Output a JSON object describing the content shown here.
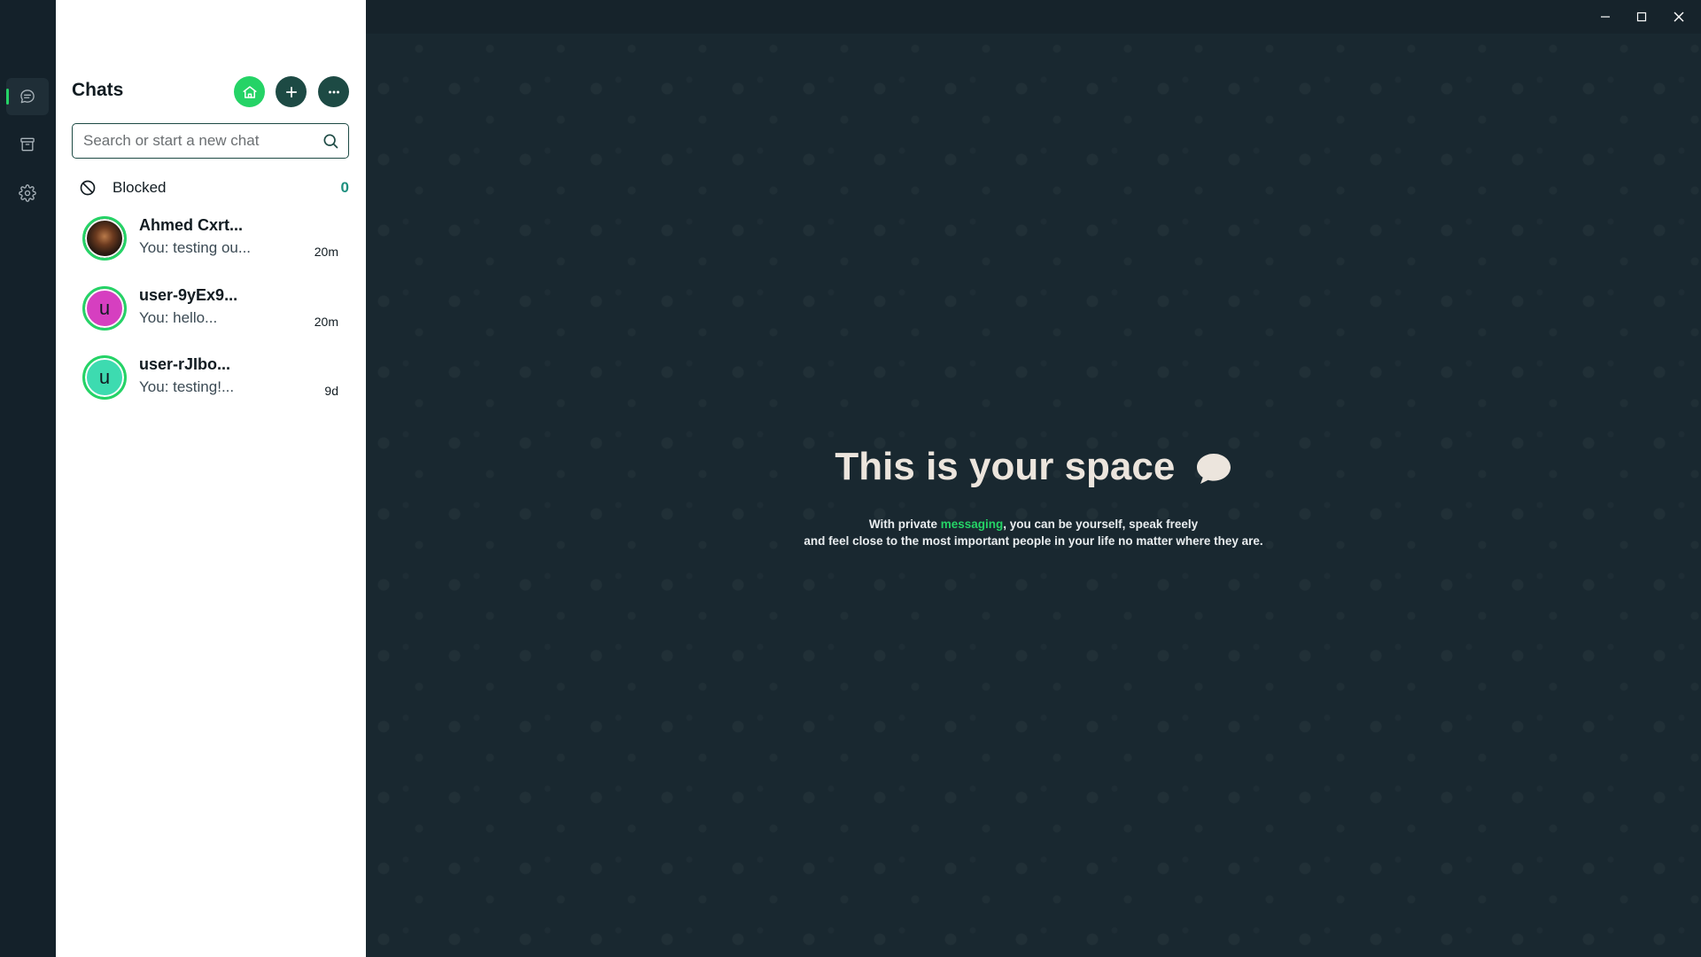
{
  "rail": {
    "items": [
      {
        "icon": "chat-icon",
        "active": true
      },
      {
        "icon": "archive-icon",
        "active": false
      },
      {
        "icon": "gear-icon",
        "active": false
      }
    ]
  },
  "panel": {
    "title": "Chats",
    "search_placeholder": "Search or start a new chat",
    "blocked_label": "Blocked",
    "blocked_count": "0"
  },
  "chats": [
    {
      "name": "Ahmed Cxrt...",
      "preview": "You: testing ou...",
      "time": "20m",
      "avatar_letter": "",
      "avatar_color": "photo"
    },
    {
      "name": "user-9yEx9...",
      "preview": "You: hello...",
      "time": "20m",
      "avatar_letter": "u",
      "avatar_color": "#d63fc0"
    },
    {
      "name": "user-rJIbo...",
      "preview": "You: testing!...",
      "time": "9d",
      "avatar_letter": "u",
      "avatar_color": "#3ddbb0"
    }
  ],
  "main": {
    "title": "This is your space",
    "subtitle_line1_pre": "With private",
    "subtitle_accent": "messaging",
    "subtitle_line1_post": ", you can be yourself, speak freely",
    "subtitle_line2": "and feel close to the most important people in your life no matter where they are."
  },
  "colors": {
    "accent": "#25d366",
    "dark_green": "#1d4a44",
    "rail_bg": "#14212a",
    "main_bg": "#192830"
  }
}
